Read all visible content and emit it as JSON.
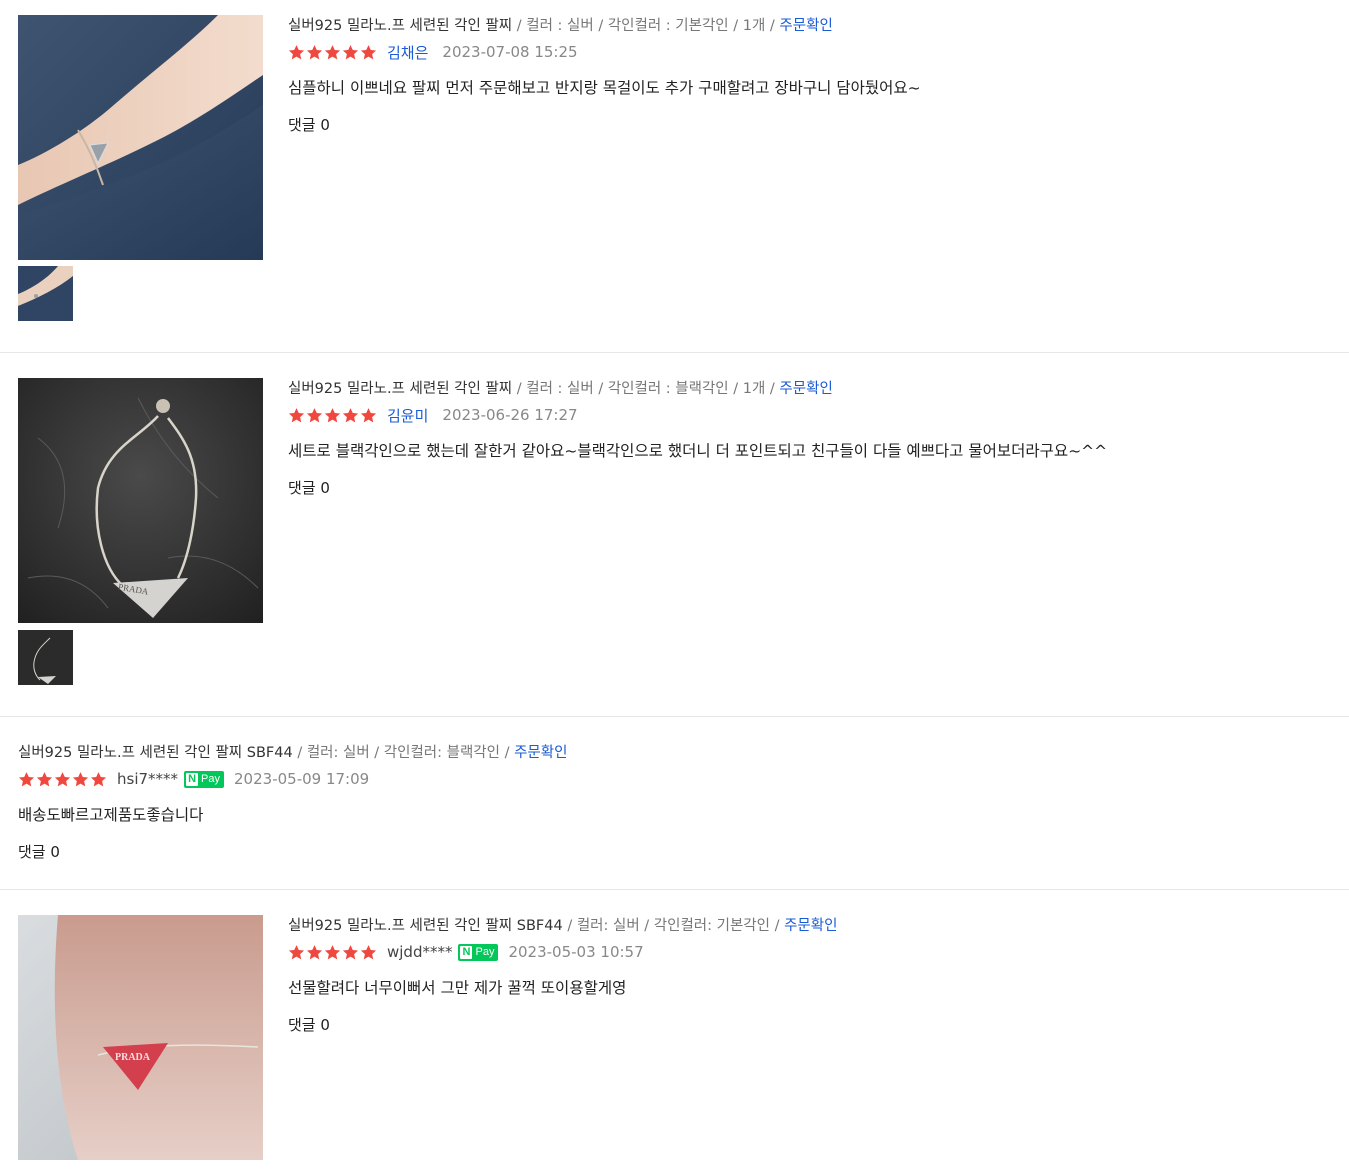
{
  "reviews": [
    {
      "product": "실버925 밀라노.프 세련된 각인 팔찌",
      "options": "컬러 : 실버 / 각인컬러 : 기본각인 / 1개",
      "order_confirm": "주문확인",
      "rating": 5,
      "author": "김채은",
      "npay": "",
      "date": "2023-07-08 15:25",
      "text": "심플하니 이쁘네요 팔찌 먼저 주문해보고 반지랑 목걸이도 추가 구매할려고 장바구니 담아뒀어요~",
      "comments": "댓글 0"
    },
    {
      "product": "실버925 밀라노.프 세련된 각인 팔찌",
      "options": "컬러 : 실버 / 각인컬러 : 블랙각인 / 1개",
      "order_confirm": "주문확인",
      "rating": 5,
      "author": "김윤미",
      "npay": "",
      "date": "2023-06-26 17:27",
      "text": "세트로 블랙각인으로 했는데 잘한거 같아요~블랙각인으로 했더니 더 포인트되고 친구들이 다들 예쁘다고 물어보더라구요~^^",
      "comments": "댓글 0"
    },
    {
      "product": "실버925 밀라노.프 세련된 각인 팔찌 SBF44",
      "options": "컬러: 실버 / 각인컬러: 블랙각인",
      "order_confirm": "주문확인",
      "rating": 5,
      "author": "hsi7****",
      "npay": "Pay",
      "date": "2023-05-09 17:09",
      "text": "배송도빠르고제품도좋습니다",
      "comments": "댓글 0"
    },
    {
      "product": "실버925 밀라노.프 세련된 각인 팔찌 SBF44",
      "options": "컬러: 실버 / 각인컬러: 기본각인",
      "order_confirm": "주문확인",
      "rating": 5,
      "author": "wjdd****",
      "npay": "Pay",
      "date": "2023-05-03 10:57",
      "text": "선물할려다 너무이뻐서 그만 제가 꿀꺽 또이용할게영",
      "comments": "댓글 0"
    }
  ],
  "colors": {
    "star": "#f0483e",
    "link": "#1a5bd6",
    "npay": "#03c75a",
    "divider": "#e8e8e8"
  },
  "icons": [
    "star-icon",
    "npay-badge"
  ],
  "photo_stamp": "PRADA"
}
